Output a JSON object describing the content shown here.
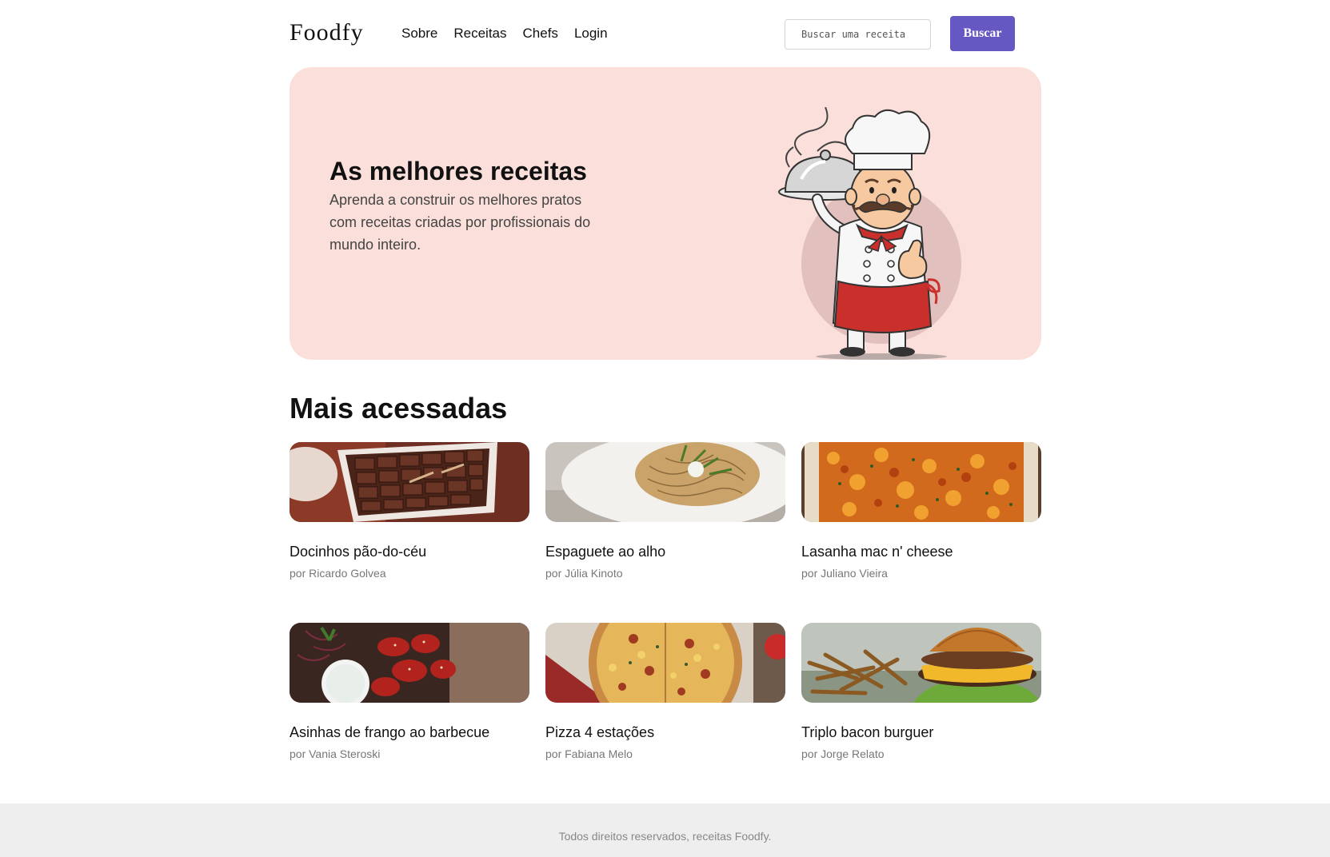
{
  "header": {
    "logo": "Foodfy",
    "nav": [
      {
        "label": "Sobre"
      },
      {
        "label": "Receitas"
      },
      {
        "label": "Chefs"
      },
      {
        "label": "Login"
      }
    ],
    "search": {
      "placeholder": "Buscar uma receita",
      "button_label": "Buscar"
    }
  },
  "hero": {
    "title": "As melhores receitas",
    "text": "Aprenda a construir os melhores pratos com receitas criadas por profissionais do mundo inteiro."
  },
  "section": {
    "title": "Mais acessadas"
  },
  "recipes": [
    {
      "title": "Docinhos pão-do-céu",
      "author": "por Ricardo Golvea"
    },
    {
      "title": "Espaguete ao alho",
      "author": "por Júlia Kinoto"
    },
    {
      "title": "Lasanha mac n' cheese",
      "author": "por Juliano Vieira"
    },
    {
      "title": "Asinhas de frango ao barbecue",
      "author": "por Vania Steroski"
    },
    {
      "title": "Pizza 4 estações",
      "author": "por Fabiana Melo"
    },
    {
      "title": "Triplo bacon burguer",
      "author": "por Jorge Relato"
    }
  ],
  "footer": {
    "text": "Todos direitos reservados, receitas Foodfy."
  },
  "colors": {
    "accent": "#6558c3",
    "hero_background": "#fbdfdb",
    "footer_background": "#eeeeee"
  }
}
